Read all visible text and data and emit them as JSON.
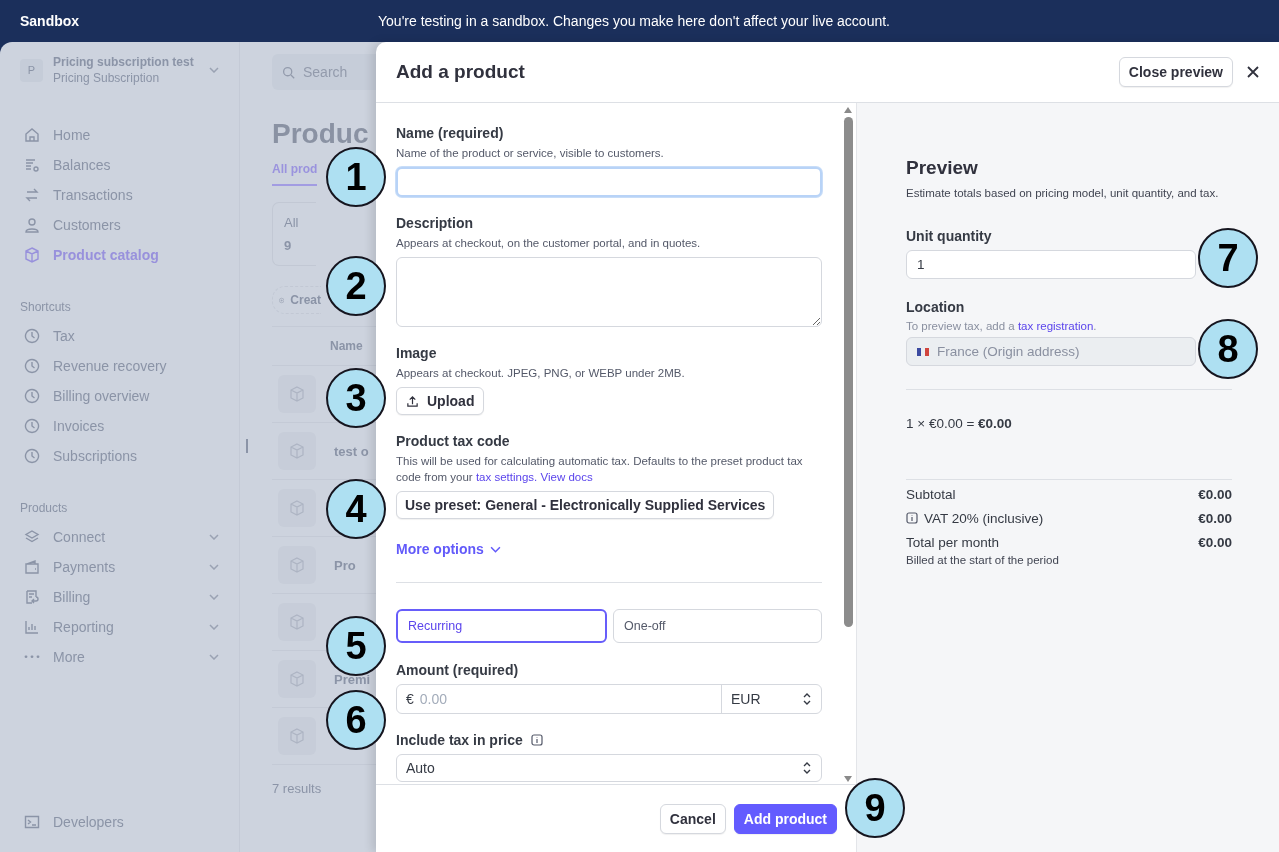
{
  "banner": {
    "label": "Sandbox",
    "message": "You're testing in a sandbox. Changes you make here don't affect your live account."
  },
  "sidebar": {
    "account": {
      "avatar": "P",
      "name": "Pricing subscription test",
      "subtitle": "Pricing Subscription"
    },
    "nav": [
      {
        "label": "Home",
        "selected": false
      },
      {
        "label": "Balances",
        "selected": false
      },
      {
        "label": "Transactions",
        "selected": false
      },
      {
        "label": "Customers",
        "selected": false
      },
      {
        "label": "Product catalog",
        "selected": true
      }
    ],
    "sections": [
      {
        "heading": "Shortcuts",
        "items": [
          {
            "label": "Tax",
            "expandable": false
          },
          {
            "label": "Revenue recovery",
            "expandable": false
          },
          {
            "label": "Billing overview",
            "expandable": false
          },
          {
            "label": "Invoices",
            "expandable": false
          },
          {
            "label": "Subscriptions",
            "expandable": false
          }
        ]
      },
      {
        "heading": "Products",
        "items": [
          {
            "label": "Connect",
            "expandable": true
          },
          {
            "label": "Payments",
            "expandable": true
          },
          {
            "label": "Billing",
            "expandable": true
          },
          {
            "label": "Reporting",
            "expandable": true
          },
          {
            "label": "More",
            "expandable": true
          }
        ]
      }
    ],
    "footer_item": {
      "label": "Developers"
    }
  },
  "page": {
    "search_placeholder": "Search",
    "title": "Produc",
    "tab": "All prod",
    "filter": {
      "label": "All",
      "count": "9"
    },
    "create_button": "Creat",
    "column_1": "Name",
    "rows": [
      {},
      {
        "name": "test o"
      },
      {},
      {
        "name": "Pro"
      },
      {},
      {
        "name": "Premi"
      },
      {}
    ],
    "results": "7 results"
  },
  "modal": {
    "title": "Add a product",
    "close_preview": "Close preview",
    "form": {
      "name": {
        "label": "Name (required)",
        "hint": "Name of the product or service, visible to customers.",
        "focused": true
      },
      "description": {
        "label": "Description",
        "hint": "Appears at checkout, on the customer portal, and in quotes."
      },
      "image": {
        "label": "Image",
        "hint": "Appears at checkout. JPEG, PNG, or WEBP under 2MB.",
        "button": "Upload"
      },
      "tax_code": {
        "label": "Product tax code",
        "hint": "This will be used for calculating automatic tax. Defaults to the preset product tax code from your ",
        "links": [
          "tax settings.",
          "View docs"
        ],
        "button": "Use preset: General - Electronically Supplied Services"
      },
      "more_options": {
        "label": "More options",
        "expanded": false
      },
      "price_types": [
        {
          "label": "Recurring",
          "selected": true
        },
        {
          "label": "One-off",
          "selected": false
        }
      ],
      "amount": {
        "label": "Amount (required)",
        "symbol": "€",
        "placeholder": "0.00",
        "currency": "EUR"
      },
      "include_tax": {
        "label": "Include tax in price",
        "value": "Auto"
      }
    },
    "footer": {
      "cancel": "Cancel",
      "submit": "Add product"
    },
    "preview": {
      "title": "Preview",
      "subtitle": "Estimate totals based on pricing model, unit quantity, and tax.",
      "quantity": {
        "label": "Unit quantity",
        "value": "1"
      },
      "location": {
        "label": "Location",
        "hint": "To preview tax, add a ",
        "link": "tax registration",
        "hint_end": ".",
        "value": "France (Origin address)",
        "disabled": true
      },
      "calculation": "1 × €0.00 = **€0.00**",
      "summary": [
        {
          "label": "Subtotal",
          "value": "€0.00",
          "kind": "plain"
        },
        {
          "label": "VAT 20% (inclusive)",
          "value": "€0.00",
          "kind": "info"
        },
        {
          "label": "Total per month",
          "value": "€0.00",
          "kind": "total",
          "note": "Billed at the start of the period"
        }
      ]
    }
  },
  "callouts": [
    "1",
    "2",
    "3",
    "4",
    "5",
    "6",
    "7",
    "8",
    "9"
  ]
}
